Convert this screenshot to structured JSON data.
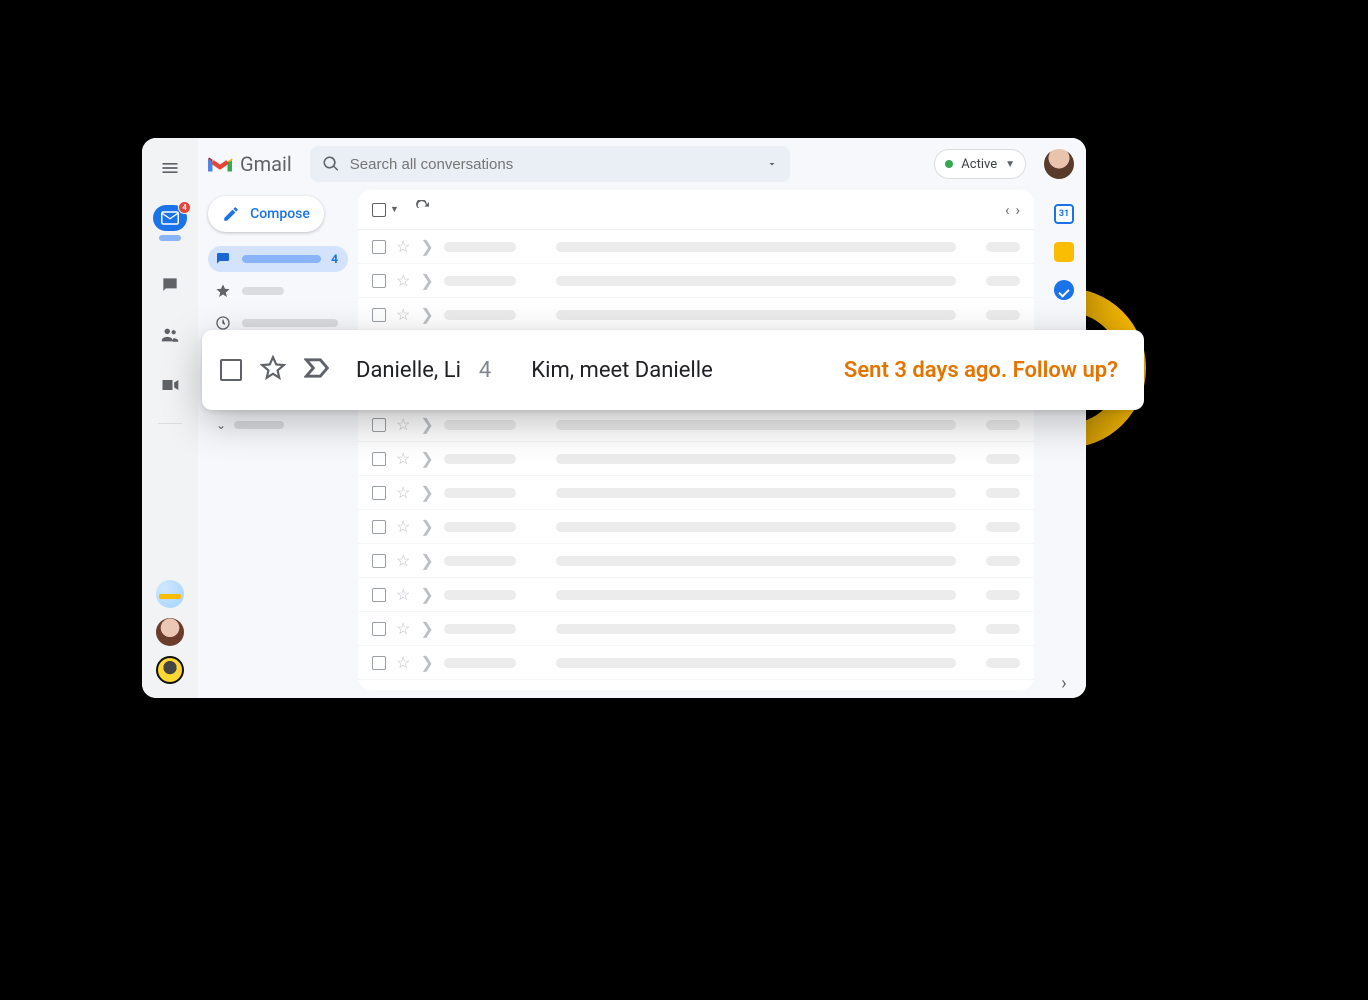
{
  "app": {
    "name": "Gmail"
  },
  "rail": {
    "mail_badge": "4"
  },
  "search": {
    "placeholder": "Search all conversations"
  },
  "status": {
    "label": "Active"
  },
  "compose": {
    "label": "Compose"
  },
  "sidebar": {
    "inbox_count": "4"
  },
  "sidepanel": {
    "calendar_day": "31"
  },
  "highlight": {
    "sender": "Danielle, Li",
    "count": "4",
    "subject": "Kim, meet Danielle",
    "nudge": "Sent 3 days ago. Follow up?"
  }
}
